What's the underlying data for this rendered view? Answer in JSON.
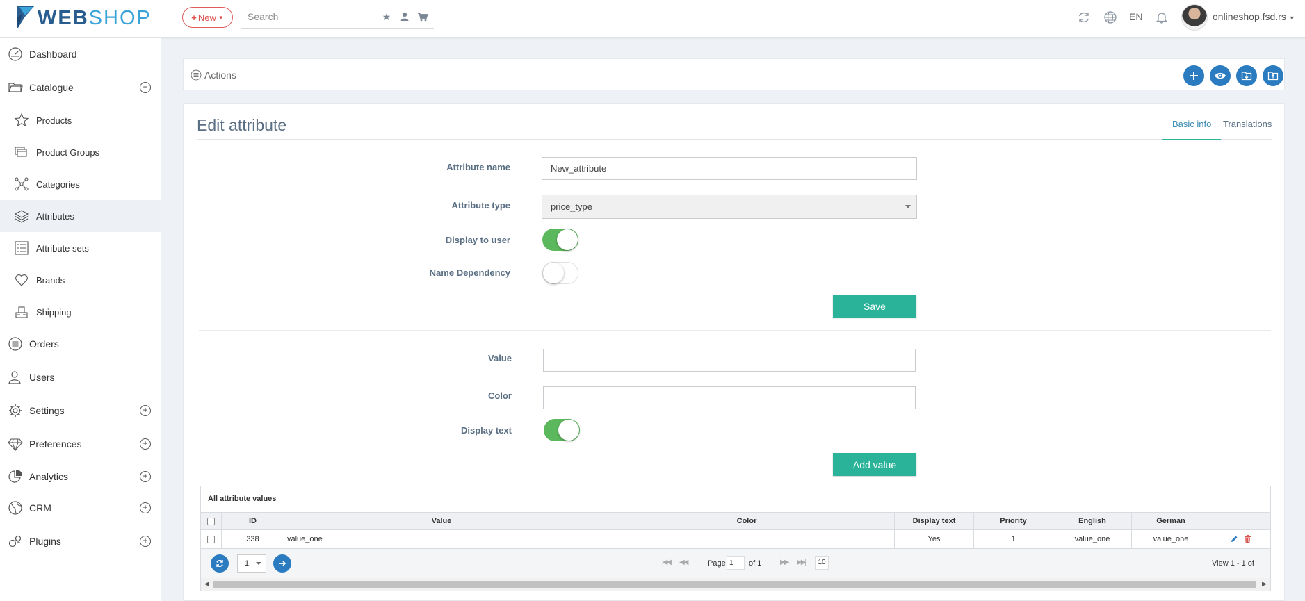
{
  "header": {
    "logo_web": "WEB",
    "logo_shop": "SHOP",
    "new_label": "New",
    "search_placeholder": "Search",
    "lang": "EN",
    "domain": "onlineshop.fsd.rs"
  },
  "sidebar": {
    "items": [
      {
        "label": "Dashboard",
        "icon": "dashboard-icon"
      },
      {
        "label": "Catalogue",
        "icon": "folder-icon",
        "toggle": "−"
      },
      {
        "label": "Products",
        "icon": "star-icon"
      },
      {
        "label": "Product Groups",
        "icon": "product-groups-icon"
      },
      {
        "label": "Categories",
        "icon": "categories-icon"
      },
      {
        "label": "Attributes",
        "icon": "layers-icon"
      },
      {
        "label": "Attribute sets",
        "icon": "list-icon"
      },
      {
        "label": "Brands",
        "icon": "heart-icon"
      },
      {
        "label": "Shipping",
        "icon": "shipping-icon"
      },
      {
        "label": "Orders",
        "icon": "orders-icon"
      },
      {
        "label": "Users",
        "icon": "users-icon"
      },
      {
        "label": "Settings",
        "icon": "gear-icon",
        "toggle": "+"
      },
      {
        "label": "Preferences",
        "icon": "diamond-icon",
        "toggle": "+"
      },
      {
        "label": "Analytics",
        "icon": "pie-chart-icon",
        "toggle": "+"
      },
      {
        "label": "CRM",
        "icon": "globe-icon",
        "toggle": "+"
      },
      {
        "label": "Plugins",
        "icon": "plugins-icon",
        "toggle": "+"
      }
    ]
  },
  "actions": {
    "label": "Actions"
  },
  "panel": {
    "title": "Edit attribute",
    "tabs": [
      "Basic info",
      "Translations"
    ]
  },
  "form": {
    "attribute_name_label": "Attribute name",
    "attribute_name_value": "New_attribute",
    "attribute_type_label": "Attribute type",
    "attribute_type_value": "price_type",
    "display_to_user_label": "Display to user",
    "display_to_user": true,
    "name_dependency_label": "Name Dependency",
    "name_dependency": false,
    "save_label": "Save"
  },
  "value_form": {
    "value_label": "Value",
    "value_value": "",
    "color_label": "Color",
    "color_value": "",
    "display_text_label": "Display text",
    "display_text": true,
    "add_label": "Add value"
  },
  "grid": {
    "caption": "All attribute values",
    "columns": [
      "ID",
      "Value",
      "Color",
      "Display text",
      "Priority",
      "English",
      "German"
    ],
    "rows": [
      {
        "id": "338",
        "value": "value_one",
        "color": "",
        "display_text": "Yes",
        "priority": "1",
        "english": "value_one",
        "german": "value_one"
      }
    ],
    "pager": {
      "page_size": "1",
      "page_label": "Page",
      "page_value": "1",
      "of_label": "of 1",
      "rows_value": "10",
      "view_label": "View 1 - 1 of"
    }
  },
  "colors": {
    "accent_green": "#2ab398",
    "toggle_on": "#5cb85c",
    "action_blue": "#2a7bbf",
    "new_red": "#d9534f"
  }
}
